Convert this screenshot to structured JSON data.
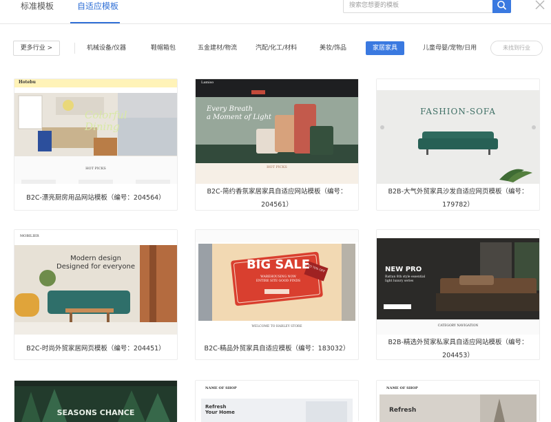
{
  "header": {
    "tabs": [
      {
        "label": "标准模板",
        "active": false
      },
      {
        "label": "自适应模板",
        "active": true
      }
    ],
    "search": {
      "placeholder": "搜索您想要的模板",
      "value": ""
    }
  },
  "category_bar": {
    "more_label": "更多行业 >",
    "categories": [
      {
        "label": "机械设备/仪器",
        "active": false
      },
      {
        "label": "鞋帽箱包",
        "active": false
      },
      {
        "label": "五金建材/物流",
        "active": false
      },
      {
        "label": "汽配/化工/材料",
        "active": false
      },
      {
        "label": "美妆/饰品",
        "active": false
      },
      {
        "label": "家居家具",
        "active": true
      },
      {
        "label": "儿童母婴/宠物/日用",
        "active": false
      }
    ],
    "not_found_label": "未找到行业"
  },
  "templates": [
    {
      "title": "B2C-漂亮厨房用品网站模板（编号：204564）",
      "thumb": {
        "brand": "Hotebu",
        "hero": "Colorful\nDining",
        "section": "HOT PICKS"
      }
    },
    {
      "title": "B2C-简约香氛家居家具自适应网站模板（编号：204561）",
      "thumb": {
        "brand": "Lamiso",
        "hero": "Every Breath\na Moment of Light",
        "section": "HOT PICKS"
      }
    },
    {
      "title": "B2B-大气外贸家具沙发自适应网页模板（编号：179782）",
      "thumb": {
        "hero": "FASHION-SOFA"
      }
    },
    {
      "title": "B2C-时尚外贸家居网页模板（编号：204451）",
      "thumb": {
        "brand": "MOBILIER",
        "hero": "Modern design\nDesigned for everyone"
      }
    },
    {
      "title": "B2C-精品外贸家具自适应模板（编号：183032）",
      "thumb": {
        "hero": "BIG SALE",
        "sub": "WAREHOUSING NOW\nENTIRE SITE GOOD FINDS",
        "tag": "UP TO 70% OFF",
        "footer": "WELCOME TO HARLEY STORE"
      }
    },
    {
      "title": "B2B-精选外贸家私家具自适应网站模板（编号：204453）",
      "thumb": {
        "hero": "NEW PRO",
        "sub": "Rattan 8th style essential\nlight luxury series",
        "section": "CATEGORY NAVIGATION"
      }
    }
  ],
  "partial_row": [
    {
      "hero": "SEASONS CHANCE"
    },
    {
      "brand": "NAME OF SHOP",
      "hero": "Refresh\nYour Home"
    },
    {
      "brand": "NAME OF SHOP",
      "hero": "Refresh"
    }
  ],
  "colors": {
    "accent": "#3a79e0",
    "tab_active": "#2f6fd6"
  }
}
